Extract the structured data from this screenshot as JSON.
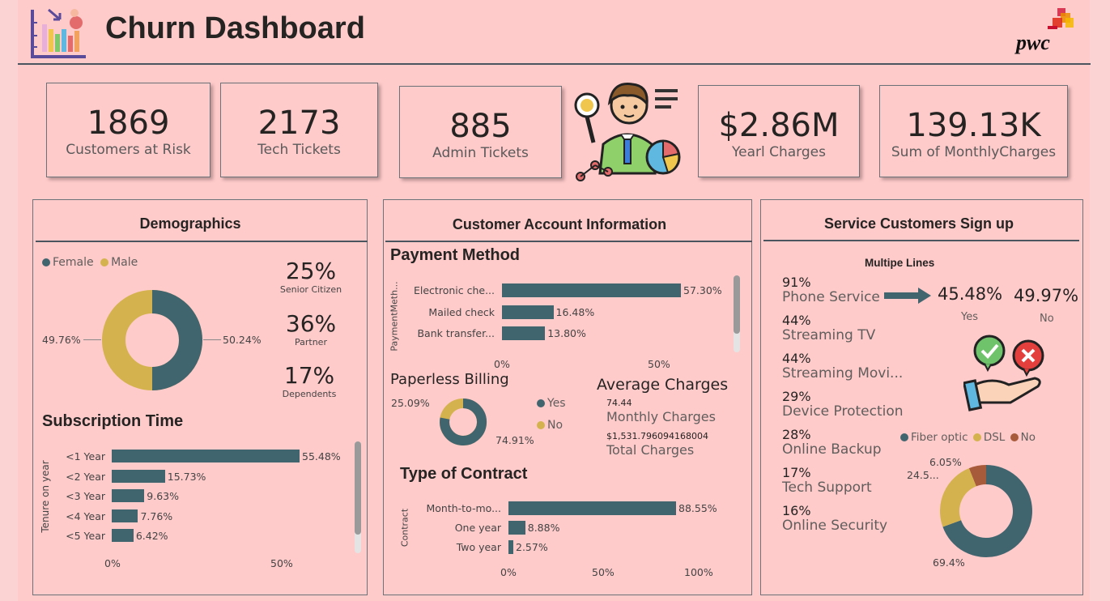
{
  "header": {
    "title": "Churn Dashboard",
    "brand": "pwc"
  },
  "kpis": [
    {
      "value": "1869",
      "label": "Customers at Risk"
    },
    {
      "value": "2173",
      "label": "Tech Tickets"
    },
    {
      "value": "885",
      "label": "Admin Tickets"
    },
    {
      "value": "$2.86M",
      "label": "Yearl Charges"
    },
    {
      "value": "139.13K",
      "label": "Sum of MonthlyCharges"
    }
  ],
  "demographics": {
    "title": "Demographics",
    "legend": [
      "Female",
      "Male"
    ],
    "gender": {
      "female_pct": 50.24,
      "male_pct": 49.76,
      "female_label": "50.24%",
      "male_label": "49.76%"
    },
    "stats": [
      {
        "value": "25%",
        "label": "Senior Citizen"
      },
      {
        "value": "36%",
        "label": "Partner"
      },
      {
        "value": "17%",
        "label": "Dependents"
      }
    ],
    "subscription": {
      "title": "Subscription Time",
      "axis_label": "Tenure on year",
      "categories": [
        "<1 Year",
        "<2 Year",
        "<3 Year",
        "<4 Year",
        "<5 Year"
      ],
      "values": [
        55.48,
        15.73,
        9.63,
        7.76,
        6.42
      ],
      "value_labels": [
        "55.48%",
        "15.73%",
        "9.63%",
        "7.76%",
        "6.42%"
      ],
      "ticks": [
        "0%",
        "50%"
      ]
    }
  },
  "account": {
    "title": "Customer Account Information",
    "payment": {
      "title": "Payment Method",
      "axis_label": "PaymentMeth...",
      "categories": [
        "Electronic che...",
        "Mailed check",
        "Bank transfer..."
      ],
      "values": [
        57.3,
        16.48,
        13.8
      ],
      "value_labels": [
        "57.30%",
        "16.48%",
        "13.80%"
      ],
      "ticks": [
        "0%",
        "50%"
      ]
    },
    "paperless": {
      "title": "Paperless Billing",
      "legend": [
        "Yes",
        "No"
      ],
      "yes_pct": 74.91,
      "no_pct": 25.09,
      "yes_label": "74.91%",
      "no_label": "25.09%"
    },
    "avg": {
      "title": "Average Charges",
      "monthly_value": "74.44",
      "monthly_label": "Monthly Charges",
      "total_value": "$1,531.796094168004",
      "total_label": "Total Charges"
    },
    "contract": {
      "title": "Type of Contract",
      "axis_label": "Contract",
      "categories": [
        "Month-to-mo...",
        "One year",
        "Two year"
      ],
      "values": [
        88.55,
        8.88,
        2.57
      ],
      "value_labels": [
        "88.55%",
        "8.88%",
        "2.57%"
      ],
      "ticks": [
        "0%",
        "50%",
        "100%"
      ]
    }
  },
  "services": {
    "title": "Service Customers Sign up",
    "items": [
      {
        "pct": "91%",
        "name": "Phone Service"
      },
      {
        "pct": "44%",
        "name": "Streaming TV"
      },
      {
        "pct": "44%",
        "name": "Streaming Movi..."
      },
      {
        "pct": "29%",
        "name": "Device Protection"
      },
      {
        "pct": "28%",
        "name": "Online Backup"
      },
      {
        "pct": "17%",
        "name": "Tech Support"
      },
      {
        "pct": "16%",
        "name": "Online Security"
      }
    ],
    "multiple_lines": {
      "title": "Multipe Lines",
      "yes_value": "45.48%",
      "yes_label": "Yes",
      "no_value": "49.97%",
      "no_label": "No"
    },
    "internet": {
      "legend": [
        "Fiber optic",
        "DSL",
        "No"
      ],
      "values": [
        69.4,
        24.5,
        6.05
      ],
      "labels": [
        "69.4%",
        "24.5...",
        "6.05%"
      ]
    }
  },
  "colors": {
    "background": "#ffcaca",
    "teal": "#41656f",
    "gold": "#d4b34e",
    "brown": "#a85b3a"
  }
}
